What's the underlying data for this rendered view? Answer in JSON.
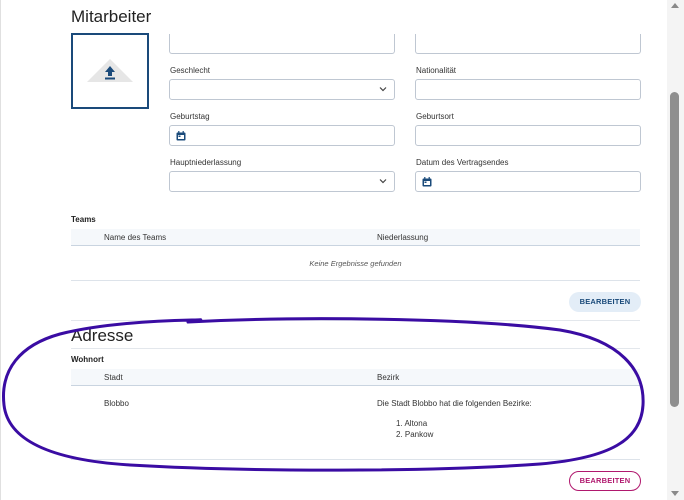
{
  "mitarbeiter": {
    "title": "Mitarbeiter",
    "fields": {
      "geschlecht": {
        "label": "Geschlecht",
        "value": ""
      },
      "nationalitaet": {
        "label": "Nationalität",
        "value": ""
      },
      "geburtstag": {
        "label": "Geburtstag",
        "value": ""
      },
      "geburtsort": {
        "label": "Geburtsort",
        "value": ""
      },
      "hauptniederlassung": {
        "label": "Hauptniederlassung",
        "value": ""
      },
      "vertragsende": {
        "label": "Datum des Vertragsendes",
        "value": ""
      }
    }
  },
  "teams": {
    "label": "Teams",
    "columns": [
      "Name des Teams",
      "Niederlassung"
    ],
    "empty_message": "Keine Ergebnisse gefunden",
    "edit_button": "BEARBEITEN"
  },
  "adresse": {
    "title": "Adresse",
    "wohnort_label": "Wohnort",
    "columns": [
      "Stadt",
      "Bezirk"
    ],
    "rows": [
      {
        "stadt": "Blobbo",
        "bezirk_intro": "Die Stadt Blobbo hat die folgenden Bezirke:",
        "bezirke": [
          "1. Altona",
          "2. Pankow"
        ]
      }
    ],
    "edit_button": "BEARBEITEN"
  },
  "colors": {
    "primary": "#1a4a7a",
    "accent": "#b0186e",
    "annotation": "#3a0ca3"
  },
  "icons": {
    "upload": "upload-arrow-icon",
    "dropdown": "chevron-down-icon",
    "calendar": "calendar-icon"
  }
}
